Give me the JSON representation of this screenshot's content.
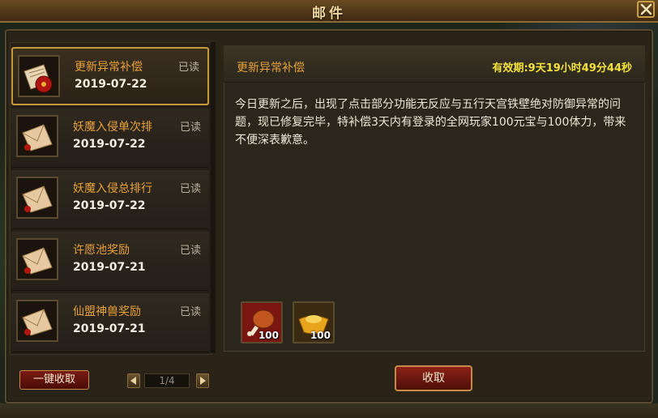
{
  "window": {
    "title": "邮件"
  },
  "mail_list": [
    {
      "title": "更新异常补偿",
      "status": "已读",
      "date": "2019-07-22",
      "icon": "envelope-with-red-bag-icon"
    },
    {
      "title": "妖魔入侵单次排",
      "status": "已读",
      "date": "2019-07-22",
      "icon": "envelope-icon"
    },
    {
      "title": "妖魔入侵总排行",
      "status": "已读",
      "date": "2019-07-22",
      "icon": "envelope-icon"
    },
    {
      "title": "许愿池奖励",
      "status": "已读",
      "date": "2019-07-21",
      "icon": "envelope-icon"
    },
    {
      "title": "仙盟神兽奖励",
      "status": "已读",
      "date": "2019-07-21",
      "icon": "envelope-icon"
    }
  ],
  "list_footer": {
    "collect_all_label": "一键收取",
    "page": "1/4"
  },
  "detail": {
    "title": "更新异常补偿",
    "expiry": "有效期:9天19小时49分44秒",
    "body": "今日更新之后，出现了点击部分功能无反应与五行天宫铁壁绝对防御异常的问题，现已修复完毕，特补偿3天内有登录的全网玩家100元宝与100体力，带来不便深表歉意。",
    "rewards": [
      {
        "icon": "chicken-leg-icon",
        "count": "100"
      },
      {
        "icon": "gold-ingot-icon",
        "count": "100"
      }
    ],
    "claim_label": "收取"
  },
  "colors": {
    "accent": "#e8a23a",
    "expiry": "#f4e23c",
    "button_red": "#8b2218"
  }
}
